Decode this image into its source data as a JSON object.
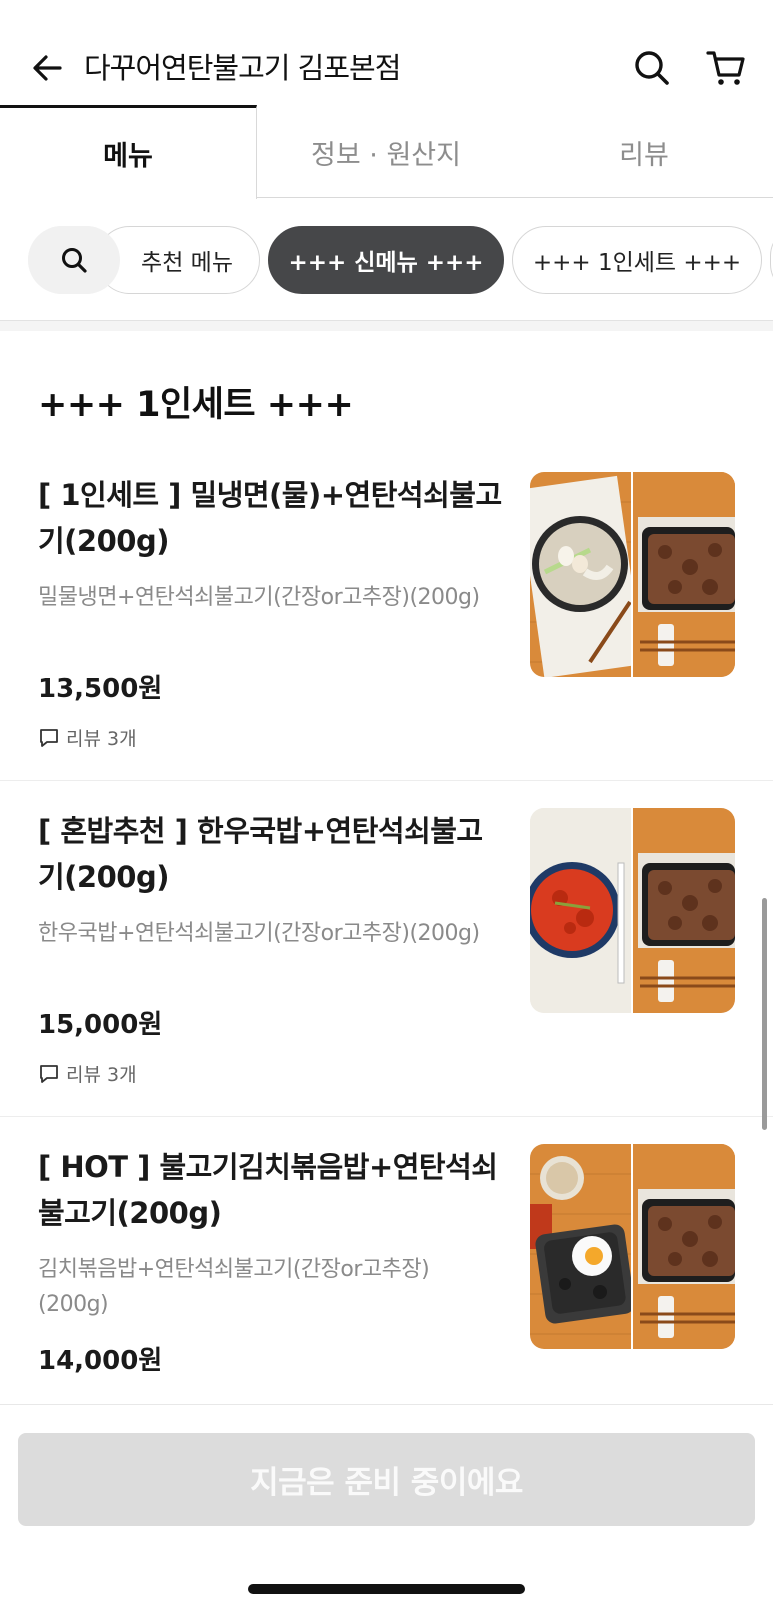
{
  "header": {
    "title": "다꾸어연탄불고기 김포본점",
    "back_icon": "arrow-left-icon",
    "search_icon": "search-icon",
    "cart_icon": "cart-icon"
  },
  "tabs": [
    {
      "label": "메뉴",
      "active": true
    },
    {
      "label": "정보 · 원산지",
      "active": false
    },
    {
      "label": "리뷰",
      "active": false
    }
  ],
  "chips": [
    {
      "label": "추천 메뉴",
      "selected": false
    },
    {
      "label": "+++ 신메뉴 +++",
      "selected": true
    },
    {
      "label": "+++ 1인세트 +++",
      "selected": false
    }
  ],
  "section": {
    "title": "+++ 1인세트 +++"
  },
  "items": [
    {
      "name": "[ 1인세트 ] 밀냉면(물)+연탄석쇠불고기(200g)",
      "desc": "밀물냉면+연탄석쇠불고기(간장or고추장)(200g)",
      "price": "13,500원",
      "review": "리뷰 3개"
    },
    {
      "name": "[ 혼밥추천 ] 한우국밥+연탄석쇠불고기(200g)",
      "desc": "한우국밥+연탄석쇠불고기(간장or고추장)(200g)",
      "price": "15,000원",
      "review": "리뷰 3개"
    },
    {
      "name": "[ HOT ] 불고기김치볶음밥+연탄석쇠불고기(200g)",
      "desc": "김치볶음밥+연탄석쇠불고기(간장or고추장)(200g)",
      "price": "14,000원",
      "review": ""
    }
  ],
  "bottom": {
    "button_label": "지금은 준비 중이에요"
  },
  "colors": {
    "chip_selected": "#464749",
    "disabled_button": "#dcdcdc",
    "wood": "#d98a3a"
  }
}
